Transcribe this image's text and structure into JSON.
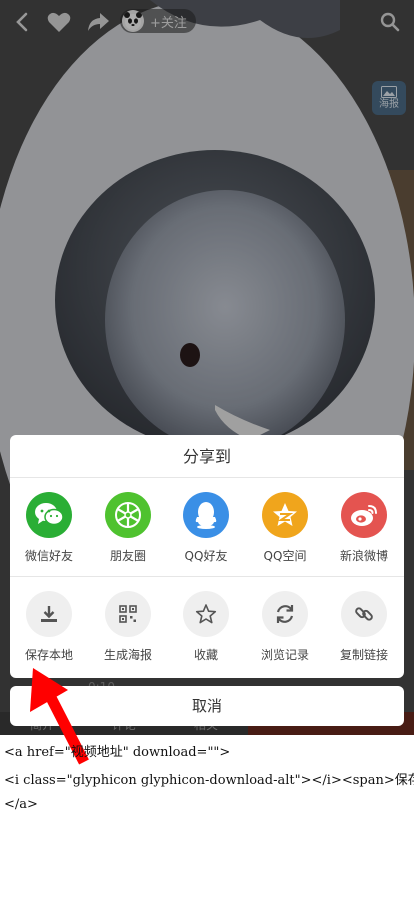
{
  "topbar": {
    "back_icon": "chevron-left-icon",
    "like_icon": "heart-icon",
    "forward_icon": "share-forward-icon",
    "avatar_icon": "panda-icon",
    "follow_label": "+关注",
    "search_icon": "search-icon"
  },
  "poster": {
    "label": "海报",
    "icon": "image-icon"
  },
  "player": {
    "time": "0:10",
    "tabs": [
      "简介",
      "评论",
      "相关"
    ]
  },
  "share_sheet": {
    "title": "分享到",
    "row1": [
      {
        "label": "微信好友",
        "icon": "wechat-icon",
        "color": "#2aae35"
      },
      {
        "label": "朋友圈",
        "icon": "moments-icon",
        "color": "#4fc22f"
      },
      {
        "label": "QQ好友",
        "icon": "qq-icon",
        "color": "#3a8fe6"
      },
      {
        "label": "QQ空间",
        "icon": "qzone-icon",
        "color": "#f0a51c"
      },
      {
        "label": "新浪微博",
        "icon": "weibo-icon",
        "color": "#e45450"
      }
    ],
    "row2": [
      {
        "label": "保存本地",
        "icon": "download-icon"
      },
      {
        "label": "生成海报",
        "icon": "qrcode-icon"
      },
      {
        "label": "收藏",
        "icon": "star-icon"
      },
      {
        "label": "浏览记录",
        "icon": "refresh-icon"
      },
      {
        "label": "复制链接",
        "icon": "link-icon"
      }
    ],
    "cancel_label": "取消"
  },
  "annotation": {
    "arrow_color": "#ff0000",
    "code_lines": [
      "<a href=\"视频地址\" download=\"\">",
      "<i class=\"glyphicon glyphicon-download-alt\"></i><span>保存本地</span>",
      "</a>"
    ]
  }
}
